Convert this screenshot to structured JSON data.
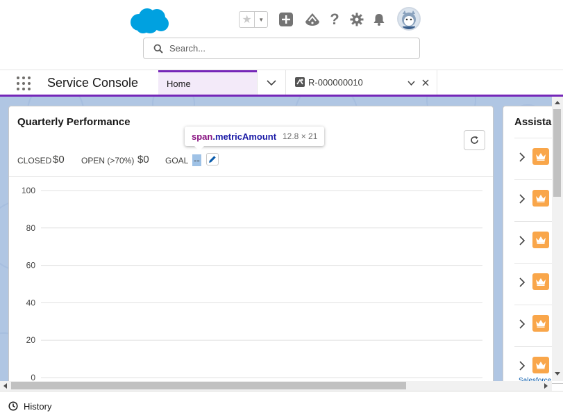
{
  "header": {
    "search": {
      "placeholder": "Search..."
    },
    "icons": [
      "favorites-star-icon",
      "favorites-dropdown-icon",
      "global-actions-add-icon",
      "trailhead-icon",
      "help-icon",
      "setup-gear-icon",
      "notifications-bell-icon"
    ],
    "help_glyph": "?"
  },
  "nav": {
    "app_name": "Service Console",
    "tabs": [
      {
        "label": "Home",
        "active": true
      },
      {
        "label": "R-000000010",
        "active": false
      }
    ]
  },
  "card": {
    "title": "Quarterly Performance",
    "metrics": {
      "closed_label": "CLOSED",
      "closed_amount": "$0",
      "open_label": "OPEN (>70%)",
      "open_amount": "$0",
      "goal_label": "GOAL",
      "goal_amount": "--"
    }
  },
  "inspector_tooltip": {
    "tag": "span",
    "class": ".metricAmount",
    "size": "12.8 × 21"
  },
  "chart_data": {
    "type": "line",
    "title": "",
    "xlabel": "",
    "ylabel": "",
    "ylim": [
      0,
      100
    ],
    "yticks": [
      "100",
      "80",
      "60",
      "40",
      "20",
      "0"
    ],
    "grid": true,
    "series": []
  },
  "assistant": {
    "title": "Assistant",
    "row_count": 6,
    "link_partial": "Salesforce"
  },
  "footer": {
    "history_label": "History"
  },
  "colors": {
    "brand_blue": "#00a1e0",
    "nav_accent": "#7526b8",
    "active_tab_bg": "#f3eaf9",
    "workspace_bg": "#b0c6e3",
    "badge_orange": "#f9a64a"
  }
}
